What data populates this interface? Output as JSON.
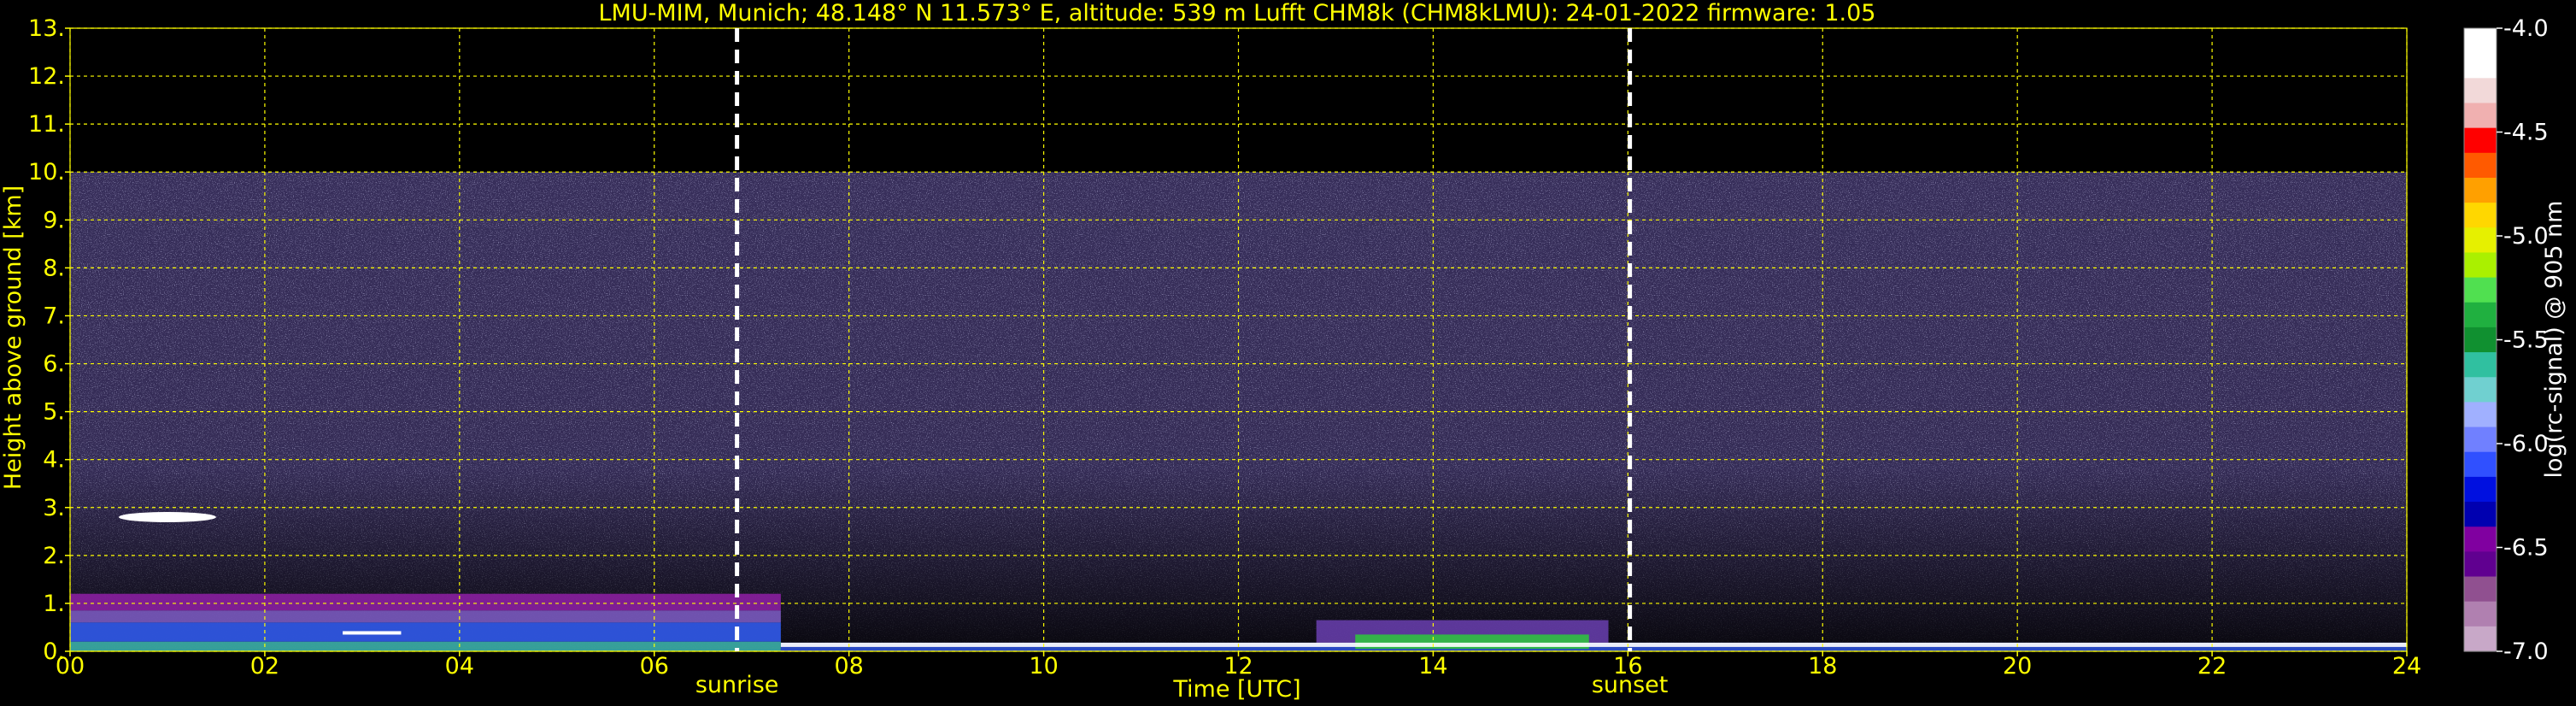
{
  "chart_data": {
    "type": "heatmap",
    "title": "LMU-MIM, Munich; 48.148° N 11.573° E, altitude: 539 m    Lufft CHM8k (CHM8kLMU): 24-01-2022    firmware: 1.05",
    "xlabel": "Time [UTC]",
    "ylabel": "Height above ground [km]",
    "xlim": [
      0,
      24
    ],
    "ylim": [
      0,
      13
    ],
    "x_ticks": [
      "00",
      "02",
      "04",
      "06",
      "08",
      "10",
      "12",
      "14",
      "16",
      "18",
      "20",
      "22",
      "24"
    ],
    "y_ticks": [
      "0.",
      "1.",
      "2.",
      "3.",
      "4.",
      "5.",
      "6.",
      "7.",
      "8.",
      "9.",
      "10.",
      "11.",
      "12.",
      "13."
    ],
    "grid": true,
    "markers": [
      {
        "label": "sunrise",
        "x": 6.85
      },
      {
        "label": "sunset",
        "x": 16.02
      }
    ],
    "colorbar": {
      "label": "log(rc-signal) @ 905 nm",
      "range": [
        -7.0,
        -4.0
      ],
      "ticks": [
        "-4.0",
        "-4.5",
        "-5.0",
        "-5.5",
        "-6.0",
        "-6.5",
        "-7.0"
      ],
      "colors": [
        "#ffffff",
        "#ffffff",
        "#f2d9d9",
        "#f0b0b0",
        "#ff0000",
        "#ff5a00",
        "#ffa000",
        "#ffd700",
        "#e6f000",
        "#aaf000",
        "#50e050",
        "#20b040",
        "#109030",
        "#30c0a0",
        "#70d0d0",
        "#a0b0ff",
        "#7080ff",
        "#3050ff",
        "#0010e0",
        "#0000b0",
        "#8000a0",
        "#600090",
        "#905090",
        "#b080b0",
        "#c8a8c8"
      ]
    },
    "features": [
      {
        "name": "boundary-layer",
        "x": [
          0,
          24
        ],
        "y": [
          0,
          1.2
        ]
      },
      {
        "name": "cloud",
        "x": [
          0.5,
          1.5
        ],
        "y": [
          2.7,
          2.9
        ]
      },
      {
        "name": "noise-top",
        "y": 10.0
      }
    ]
  }
}
